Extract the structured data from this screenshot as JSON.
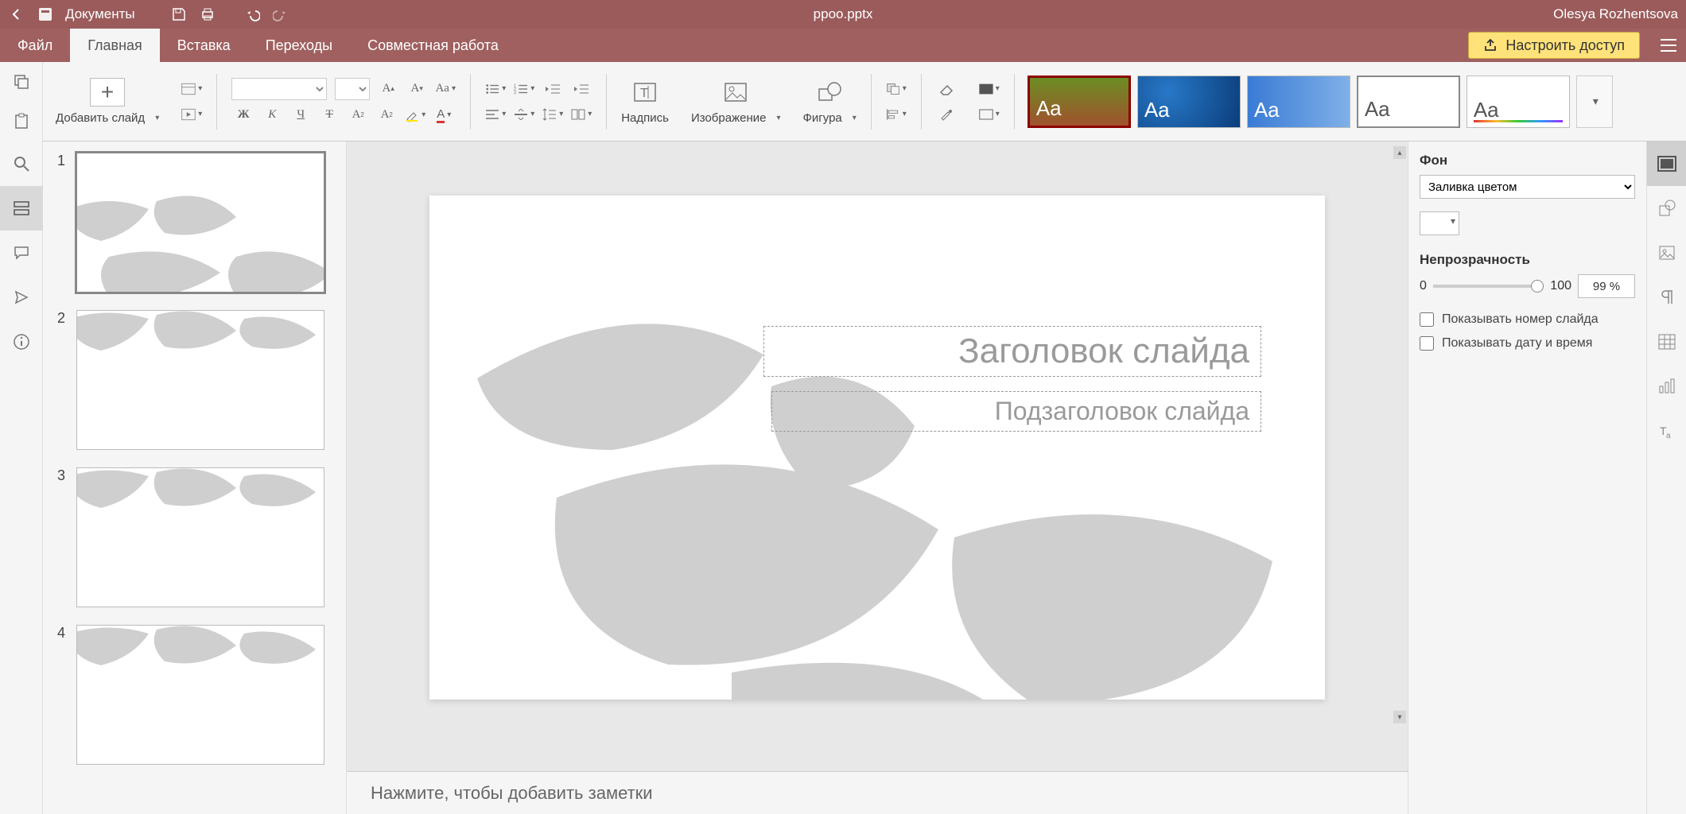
{
  "titlebar": {
    "app_name": "Документы",
    "filename": "ppoo.pptx",
    "user": "Olesya Rozhentsova"
  },
  "menubar": {
    "file": "Файл",
    "home": "Главная",
    "insert": "Вставка",
    "transitions": "Переходы",
    "collaboration": "Совместная работа",
    "share": "Настроить доступ"
  },
  "toolbar": {
    "add_slide": "Добавить слайд",
    "textbox": "Надпись",
    "image": "Изображение",
    "shape": "Фигура",
    "theme_label": "Aa"
  },
  "slides": {
    "count": 4,
    "nums": [
      "1",
      "2",
      "3",
      "4"
    ]
  },
  "canvas": {
    "title_placeholder": "Заголовок слайда",
    "subtitle_placeholder": "Подзаголовок слайда",
    "notes_placeholder": "Нажмите, чтобы добавить заметки"
  },
  "rpanel": {
    "bg_label": "Фон",
    "fill_option": "Заливка цветом",
    "opacity_label": "Непрозрачность",
    "opacity_min": "0",
    "opacity_max": "100",
    "opacity_value": "99 %",
    "show_number": "Показывать номер слайда",
    "show_date": "Показывать дату и время"
  }
}
